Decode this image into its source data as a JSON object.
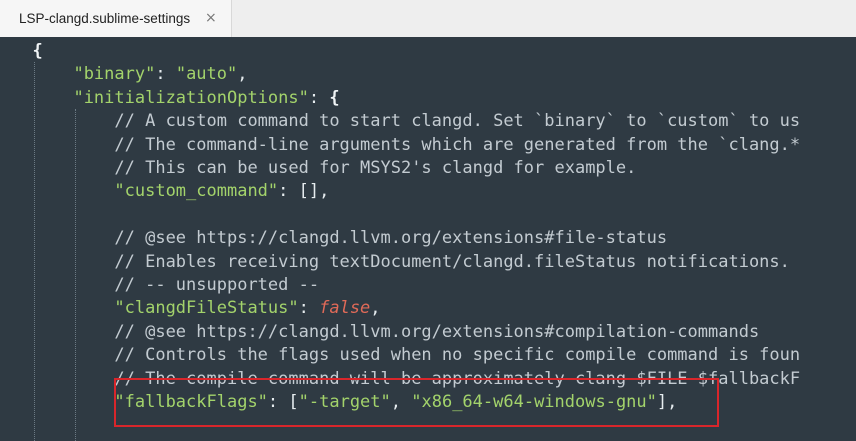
{
  "tab": {
    "title": "LSP-clangd.sublime-settings",
    "close_glyph": "×"
  },
  "code": {
    "lines": [
      {
        "indent": "",
        "parts": [
          {
            "t": "{",
            "c": "brace"
          }
        ]
      },
      {
        "indent": "    ",
        "parts": [
          {
            "t": "\"binary\"",
            "c": "key"
          },
          {
            "t": ": ",
            "c": "punc"
          },
          {
            "t": "\"auto\"",
            "c": "str"
          },
          {
            "t": ",",
            "c": "punc"
          }
        ]
      },
      {
        "indent": "    ",
        "parts": [
          {
            "t": "\"initializationOptions\"",
            "c": "key"
          },
          {
            "t": ": ",
            "c": "punc"
          },
          {
            "t": "{",
            "c": "brace"
          }
        ]
      },
      {
        "indent": "        ",
        "parts": [
          {
            "t": "// A custom command to start clangd. Set `binary` to `custom` to us",
            "c": "cmt"
          }
        ]
      },
      {
        "indent": "        ",
        "parts": [
          {
            "t": "// The command-line arguments which are generated from the `clang.*",
            "c": "cmt"
          }
        ]
      },
      {
        "indent": "        ",
        "parts": [
          {
            "t": "// This can be used for MSYS2's clangd for example.",
            "c": "cmt"
          }
        ]
      },
      {
        "indent": "        ",
        "parts": [
          {
            "t": "\"custom_command\"",
            "c": "key"
          },
          {
            "t": ": [],",
            "c": "punc"
          }
        ]
      },
      {
        "indent": "",
        "parts": []
      },
      {
        "indent": "        ",
        "parts": [
          {
            "t": "// @see https://clangd.llvm.org/extensions#file-status",
            "c": "cmt"
          }
        ]
      },
      {
        "indent": "        ",
        "parts": [
          {
            "t": "// Enables receiving textDocument/clangd.fileStatus notifications.",
            "c": "cmt"
          }
        ]
      },
      {
        "indent": "        ",
        "parts": [
          {
            "t": "// -- unsupported --",
            "c": "cmt"
          }
        ]
      },
      {
        "indent": "        ",
        "parts": [
          {
            "t": "\"clangdFileStatus\"",
            "c": "key"
          },
          {
            "t": ": ",
            "c": "punc"
          },
          {
            "t": "false",
            "c": "bool"
          },
          {
            "t": ",",
            "c": "punc"
          }
        ]
      },
      {
        "indent": "        ",
        "parts": [
          {
            "t": "// @see https://clangd.llvm.org/extensions#compilation-commands",
            "c": "cmt"
          }
        ]
      },
      {
        "indent": "        ",
        "parts": [
          {
            "t": "// Controls the flags used when no specific compile command is foun",
            "c": "cmt"
          }
        ]
      },
      {
        "indent": "        ",
        "parts": [
          {
            "t": "// The compile command will be approximately clang $FILE $fallbackF",
            "c": "cmt"
          }
        ]
      },
      {
        "indent": "        ",
        "parts": [
          {
            "t": "\"fallbackFlags\"",
            "c": "key"
          },
          {
            "t": ": [",
            "c": "punc"
          },
          {
            "t": "\"-target\"",
            "c": "str"
          },
          {
            "t": ", ",
            "c": "punc"
          },
          {
            "t": "\"x86_64-w64-windows-gnu\"",
            "c": "str"
          },
          {
            "t": "],",
            "c": "punc"
          }
        ]
      }
    ]
  },
  "colors": {
    "background": "#2f3a43",
    "string": "#a3d36b",
    "comment": "#c3cbd1",
    "boolean": "#e06a58",
    "highlight_border": "#d9262b"
  }
}
